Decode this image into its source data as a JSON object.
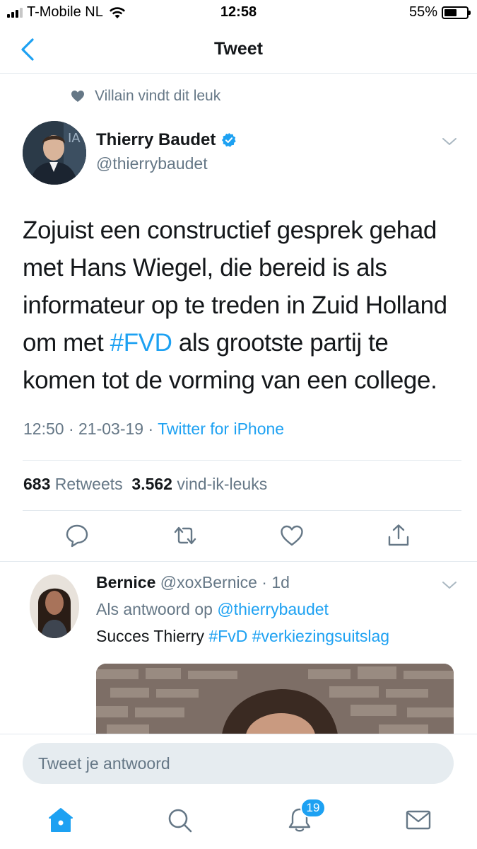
{
  "status_bar": {
    "carrier": "T-Mobile NL",
    "time": "12:58",
    "battery": "55%",
    "battery_level": 0.55
  },
  "nav": {
    "title": "Tweet"
  },
  "social_context": {
    "text": "Villain vindt dit leuk"
  },
  "tweet": {
    "author_name": "Thierry Baudet",
    "author_handle": "@thierrybaudet",
    "text_before": "Zojuist een constructief gesprek gehad met Hans Wiegel, die bereid is als informateur op te treden in Zuid Holland om met ",
    "hashtag": "#FVD",
    "text_after": " als grootste partij te komen tot de vorming van een college.",
    "time": "12:50",
    "date": "21-03-19",
    "source": "Twitter for iPhone",
    "retweets_count": "683",
    "retweets_label": "Retweets",
    "likes_count": "3.562",
    "likes_label": "vind-ik-leuks"
  },
  "reply": {
    "name": "Bernice",
    "handle": "@xoxBernice",
    "time": "1d",
    "reply_to_label": "Als antwoord op",
    "reply_to_handle": "@thierrybaudet",
    "text": "Succes Thierry",
    "hashtag1": "#FvD",
    "hashtag2": "#verkiezingsuitslag"
  },
  "compose": {
    "placeholder": "Tweet je antwoord"
  },
  "tabbar": {
    "notifications_badge": "19"
  },
  "colors": {
    "accent": "#1da1f2",
    "secondary_text": "#657786",
    "divider": "#e1e8ed"
  }
}
